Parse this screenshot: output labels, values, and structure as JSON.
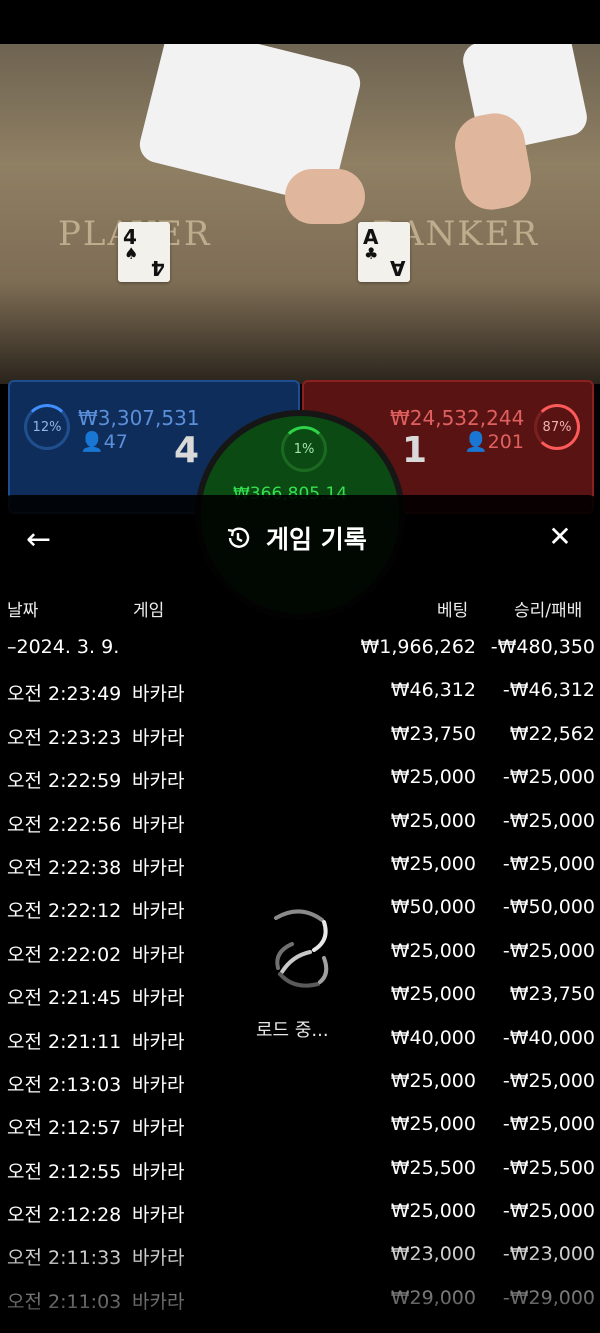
{
  "video": {
    "player_label": "PLAYER",
    "banker_label": "BANKER",
    "player_card": {
      "rank": "4",
      "suit": "♠"
    },
    "banker_card": {
      "rank": "A",
      "suit": "♣"
    }
  },
  "bets": {
    "player": {
      "percent": "12%",
      "amount": "₩3,307,531",
      "count": "47",
      "score": "4"
    },
    "tie": {
      "percent": "1%",
      "amount": "₩366,805.14"
    },
    "banker": {
      "percent": "87%",
      "amount": "₩24,532,244",
      "count": "201",
      "score": "1"
    }
  },
  "history": {
    "title": "게임 기록",
    "back_icon": "arrow-left-icon",
    "history_icon": "history-icon",
    "close_icon": "close-icon",
    "columns": {
      "date": "날짜",
      "game": "게임",
      "bet": "베팅",
      "result": "승리/패배"
    },
    "rows": [
      {
        "date": "–2024. 3. 9.",
        "game": "",
        "bet": "₩1,966,262",
        "result": "-₩480,350"
      },
      {
        "date": "오전 2:23:49",
        "game": "바카라",
        "bet": "₩46,312",
        "result": "-₩46,312"
      },
      {
        "date": "오전 2:23:23",
        "game": "바카라",
        "bet": "₩23,750",
        "result": "₩22,562"
      },
      {
        "date": "오전 2:22:59",
        "game": "바카라",
        "bet": "₩25,000",
        "result": "-₩25,000"
      },
      {
        "date": "오전 2:22:56",
        "game": "바카라",
        "bet": "₩25,000",
        "result": "-₩25,000"
      },
      {
        "date": "오전 2:22:38",
        "game": "바카라",
        "bet": "₩25,000",
        "result": "-₩25,000"
      },
      {
        "date": "오전 2:22:12",
        "game": "바카라",
        "bet": "₩50,000",
        "result": "-₩50,000"
      },
      {
        "date": "오전 2:22:02",
        "game": "바카라",
        "bet": "₩25,000",
        "result": "-₩25,000"
      },
      {
        "date": "오전 2:21:45",
        "game": "바카라",
        "bet": "₩25,000",
        "result": "₩23,750"
      },
      {
        "date": "오전 2:21:11",
        "game": "바카라",
        "bet": "₩40,000",
        "result": "-₩40,000"
      },
      {
        "date": "오전 2:13:03",
        "game": "바카라",
        "bet": "₩25,000",
        "result": "-₩25,000"
      },
      {
        "date": "오전 2:12:57",
        "game": "바카라",
        "bet": "₩25,000",
        "result": "-₩25,000"
      },
      {
        "date": "오전 2:12:55",
        "game": "바카라",
        "bet": "₩25,500",
        "result": "-₩25,500"
      },
      {
        "date": "오전 2:12:28",
        "game": "바카라",
        "bet": "₩25,000",
        "result": "-₩25,000"
      },
      {
        "date": "오전 2:11:33",
        "game": "바카라",
        "bet": "₩23,000",
        "result": "-₩23,000"
      },
      {
        "date": "오전 2:11:03",
        "game": "바카라",
        "bet": "₩29,000",
        "result": "-₩29,000"
      }
    ],
    "loading_text": "로드 중...",
    "loading_icon": "loading-spinner-icon"
  }
}
